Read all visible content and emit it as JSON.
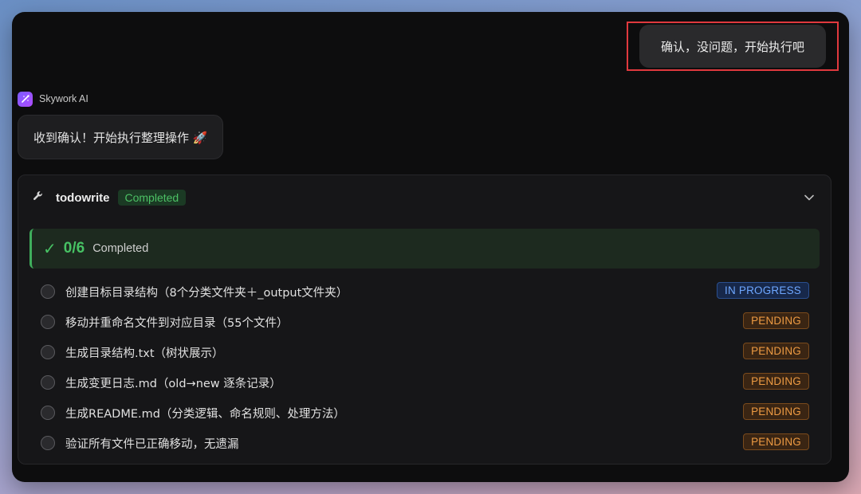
{
  "user_message": "确认，没问题，开始执行吧",
  "assistant": {
    "name": "Skywork AI",
    "message": "收到确认！开始执行整理操作 🚀"
  },
  "tool": {
    "name": "todowrite",
    "status": "Completed",
    "progress": {
      "count": "0/6",
      "label": "Completed"
    },
    "tasks": [
      {
        "text": "创建目标目录结构（8个分类文件夹＋_output文件夹）",
        "status": "IN PROGRESS"
      },
      {
        "text": "移动并重命名文件到对应目录（55个文件）",
        "status": "PENDING"
      },
      {
        "text": "生成目录结构.txt（树状展示）",
        "status": "PENDING"
      },
      {
        "text": "生成变更日志.md（old→new 逐条记录）",
        "status": "PENDING"
      },
      {
        "text": "生成README.md（分类逻辑、命名规则、处理方法）",
        "status": "PENDING"
      },
      {
        "text": "验证所有文件已正确移动，无遗漏",
        "status": "PENDING"
      }
    ]
  },
  "icons": {
    "logo": "skywork-logo-icon",
    "tool": "wrench-icon",
    "expand": "chevron-down-icon",
    "check": "check-icon"
  },
  "colors": {
    "highlight": "#e0393e",
    "completed": "#47c264",
    "in_progress": "#6ea7ff",
    "pending": "#ee9b43"
  }
}
